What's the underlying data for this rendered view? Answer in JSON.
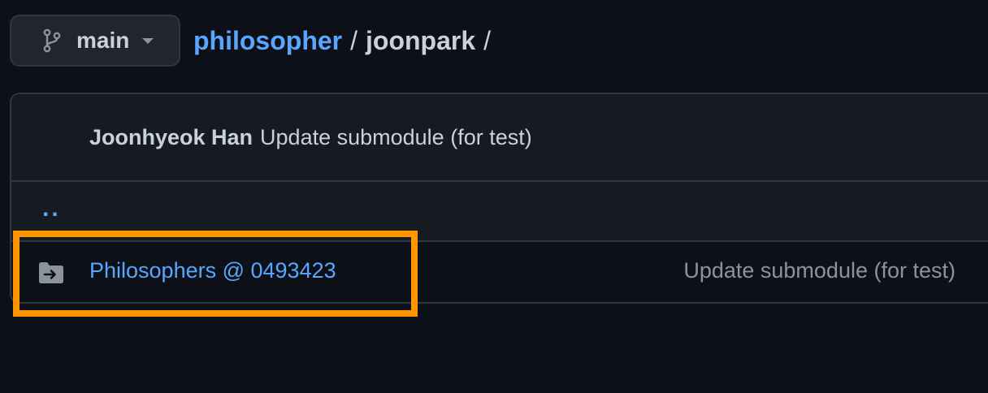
{
  "branch": {
    "label": "main"
  },
  "breadcrumb": {
    "repo": "philosopher",
    "separator": "/",
    "folder": "joonpark",
    "trailing_separator": "/"
  },
  "commit": {
    "author": "Joonhyeok Han",
    "message": "Update submodule (for test)"
  },
  "parent_dir": {
    "label": ".."
  },
  "files": [
    {
      "icon": "submodule-folder-icon",
      "name": "Philosophers @ 0493423",
      "commit_message": "Update submodule (for test)"
    }
  ],
  "colors": {
    "background": "#0d1117",
    "link": "#58a6ff",
    "text": "#c9d1d9",
    "muted": "#8b949e",
    "border": "#30363d",
    "highlight": "#ff9500"
  }
}
